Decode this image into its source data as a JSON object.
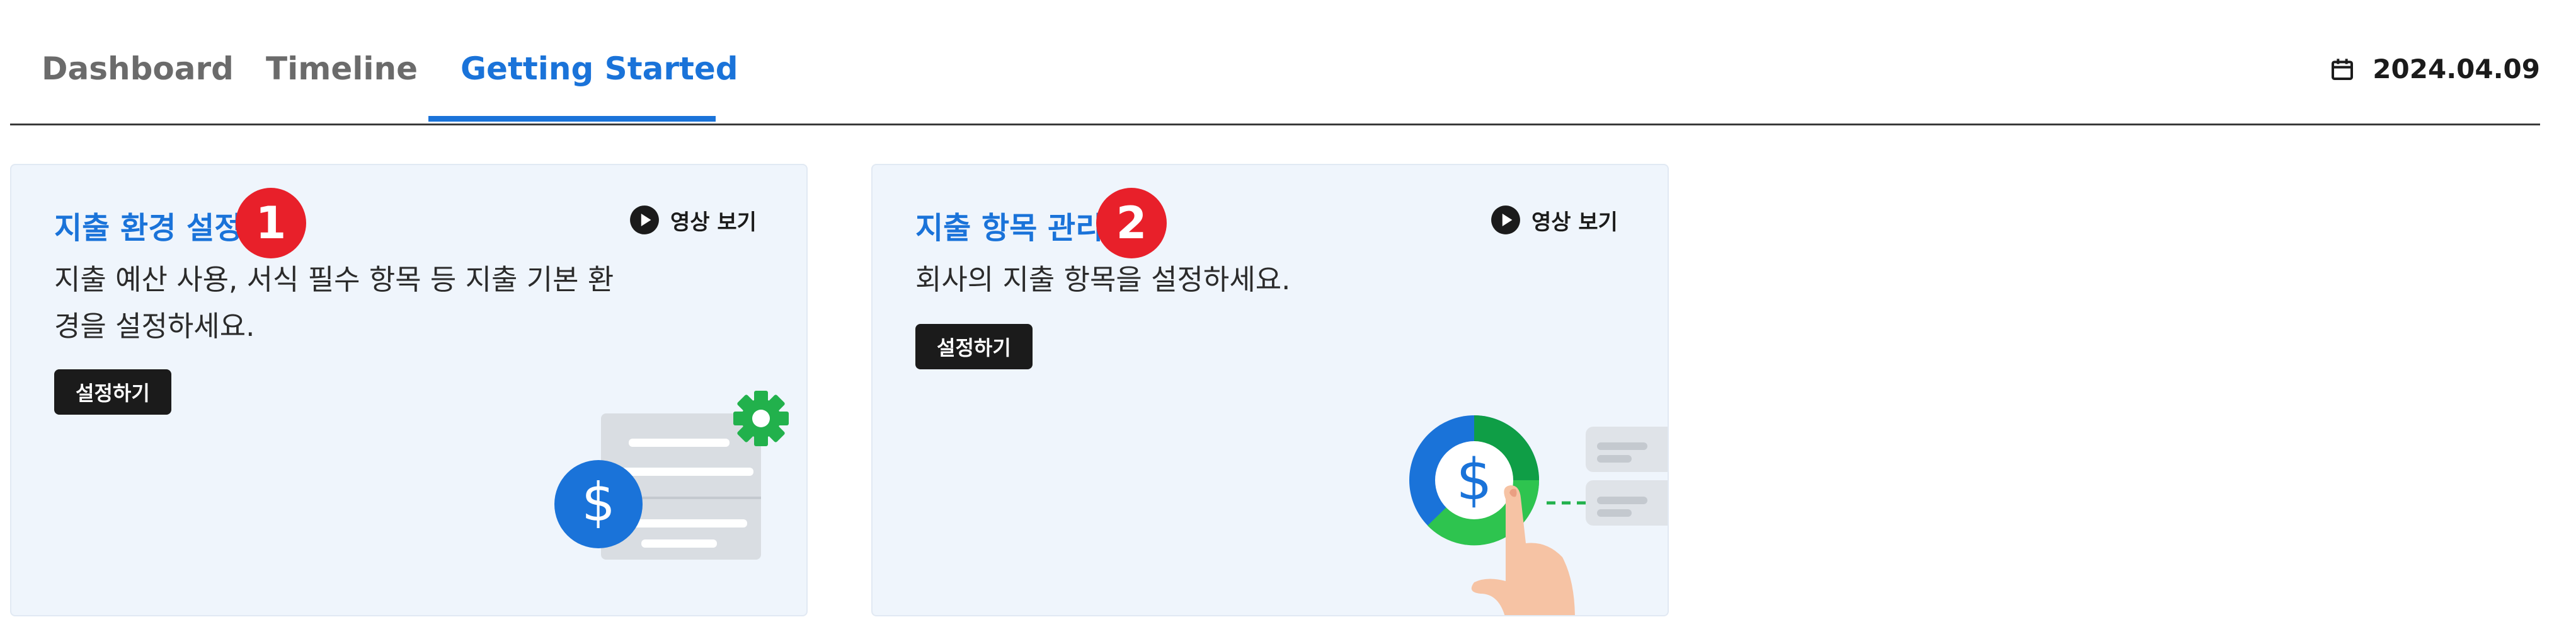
{
  "tabs": [
    {
      "label": "Dashboard",
      "active": false
    },
    {
      "label": "Timeline",
      "active": false
    },
    {
      "label": "Getting Started",
      "active": true
    }
  ],
  "date": {
    "icon": "calendar-icon",
    "value": "2024.04.09"
  },
  "colors": {
    "accent": "#1a73d9",
    "badge": "#e8202a",
    "card_bg": "#eff5fc",
    "button_bg": "#1b1b1b"
  },
  "cards": [
    {
      "title": "지출 환경 설정",
      "step": "1",
      "video_label": "영상 보기",
      "video_icon": "play-circle-icon",
      "description": "지출 예산 사용, 서식 필수 항목 등 지출 기본 환경을 설정하세요.",
      "button_label": "설정하기",
      "illustration": "settings-document-dollar-illustration"
    },
    {
      "title": "지출 항목 관리",
      "step": "2",
      "video_label": "영상 보기",
      "video_icon": "play-circle-icon",
      "description": "회사의 지출 항목을 설정하세요.",
      "button_label": "설정하기",
      "illustration": "donut-chart-dollar-illustration"
    }
  ]
}
